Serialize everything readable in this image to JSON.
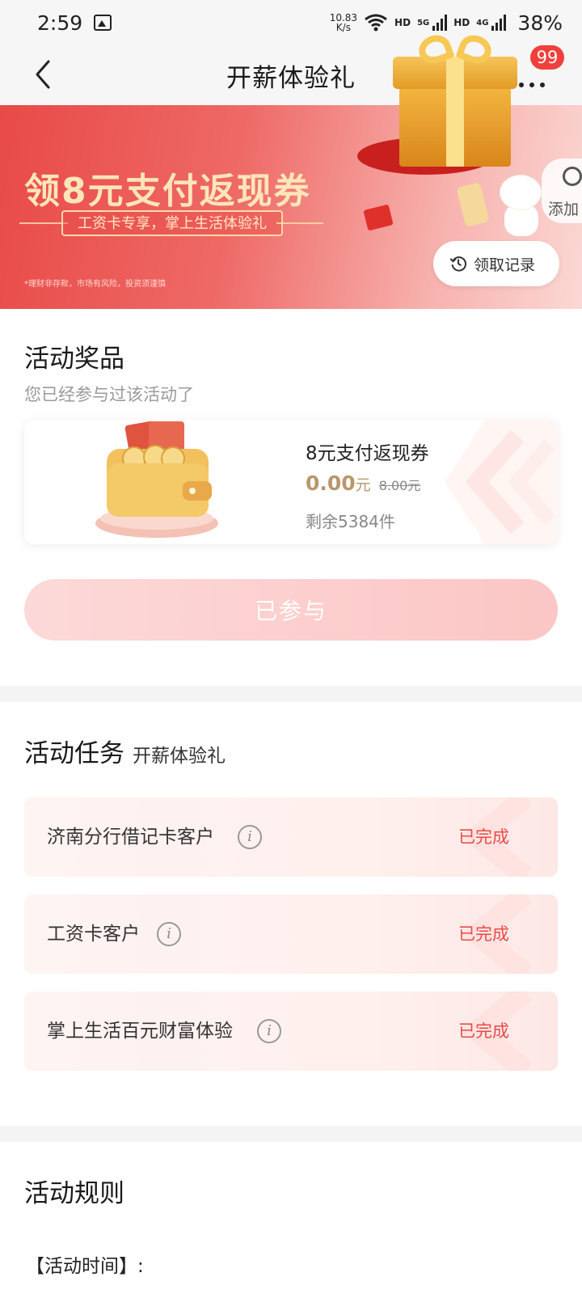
{
  "status_bar": {
    "time": "2:59",
    "net_speed_value": "10.83",
    "net_speed_unit": "K/s",
    "hd1": "HD",
    "net1": "5G",
    "hd2": "HD",
    "net2": "4G",
    "battery": "38%"
  },
  "nav": {
    "title": "开薪体验礼",
    "badge": "99"
  },
  "banner": {
    "title": "领8元支付返现券",
    "subtitle": "工资卡专享，掌上生活体验礼",
    "disclaimer": "*理财非存款，市场有风险，投资须谨慎",
    "add_label": "添加",
    "record_label": "领取记录"
  },
  "prize": {
    "section_title": "活动奖品",
    "subtitle": "您已经参与过该活动了",
    "name": "8元支付返现券",
    "price": "0.00",
    "unit": "元",
    "original_price": "8.00元",
    "remaining": "剩余5384件",
    "button_label": "已参与"
  },
  "tasks": {
    "section_title": "活动任务",
    "subtitle": "开薪体验礼",
    "items": [
      {
        "label": "济南分行借记卡客户",
        "status": "已完成"
      },
      {
        "label": "工资卡客户",
        "status": "已完成"
      },
      {
        "label": "掌上生活百元财富体验",
        "status": "已完成"
      }
    ]
  },
  "rules": {
    "section_title": "活动规则",
    "time_label": "【活动时间】:"
  },
  "colors": {
    "accent_red": "#e84a47",
    "gold_text": "#b8976a",
    "badge_red": "#f0403c"
  }
}
